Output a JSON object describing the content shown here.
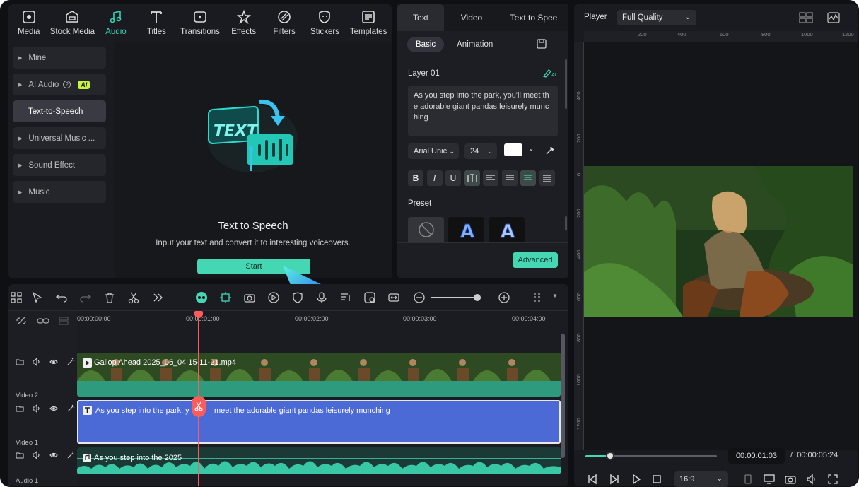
{
  "nav": {
    "items": [
      {
        "label": "Media",
        "icon": "media-icon"
      },
      {
        "label": "Stock Media",
        "icon": "stock-media-icon"
      },
      {
        "label": "Audio",
        "icon": "audio-icon"
      },
      {
        "label": "Titles",
        "icon": "titles-icon"
      },
      {
        "label": "Transitions",
        "icon": "transitions-icon"
      },
      {
        "label": "Effects",
        "icon": "effects-icon"
      },
      {
        "label": "Filters",
        "icon": "filters-icon"
      },
      {
        "label": "Stickers",
        "icon": "stickers-icon"
      },
      {
        "label": "Templates",
        "icon": "templates-icon"
      }
    ],
    "active": "Audio",
    "accent": "#35d4b4"
  },
  "sidebar": {
    "items": [
      {
        "label": "Mine"
      },
      {
        "label": "AI Audio",
        "badge": "AI"
      },
      {
        "label": "Text-to-Speech"
      },
      {
        "label": "Universal Music ..."
      },
      {
        "label": "Sound Effect"
      },
      {
        "label": "Music"
      }
    ]
  },
  "tts": {
    "graphic_text": "TEXT",
    "title": "Text to Speech",
    "description": "Input your text and convert it to interesting voiceovers.",
    "start_label": "Start"
  },
  "props": {
    "tabs": [
      "Text",
      "Video",
      "Text to Spee"
    ],
    "subtabs": [
      "Basic",
      "Animation"
    ],
    "layer_label": "Layer 01",
    "text_content": "As you step into the park, you'll meet the adorable giant pandas leisurely munching",
    "font": "Arial Unic",
    "size": "24",
    "color": "#ffffff",
    "preset_label": "Preset",
    "advanced_label": "Advanced"
  },
  "player": {
    "label": "Player",
    "quality": "Full Quality",
    "ruler_h": [
      "200",
      "400",
      "600",
      "800",
      "1000",
      "1200"
    ],
    "ruler_v": [
      "400",
      "200",
      "0",
      "200",
      "400",
      "600",
      "800",
      "1000",
      "1200"
    ],
    "current_time": "00:00:01:03",
    "separator": "/",
    "total_time": "00:00:05:24",
    "ratio": "16:9",
    "progress": 0.19
  },
  "timeline": {
    "ruler": [
      "00:00:00:00",
      "00:00:01:00",
      "00:00:02:00",
      "00:00:03:00",
      "00:00:04:00"
    ],
    "tracks": [
      {
        "label": "Video 2",
        "clip": "Gallop Ahead 2025_06_04 15-11-21.mp4"
      },
      {
        "label": "Video 1",
        "clip": "As you step into the park, you'll meet the adorable giant pandas leisurely munching"
      },
      {
        "label": "Audio 1",
        "clip": "As you step into the 2025"
      }
    ],
    "title_clip_text_part1": "As you step into the park, y",
    "title_clip_text_part2": "meet the adorable giant pandas leisurely munching"
  }
}
